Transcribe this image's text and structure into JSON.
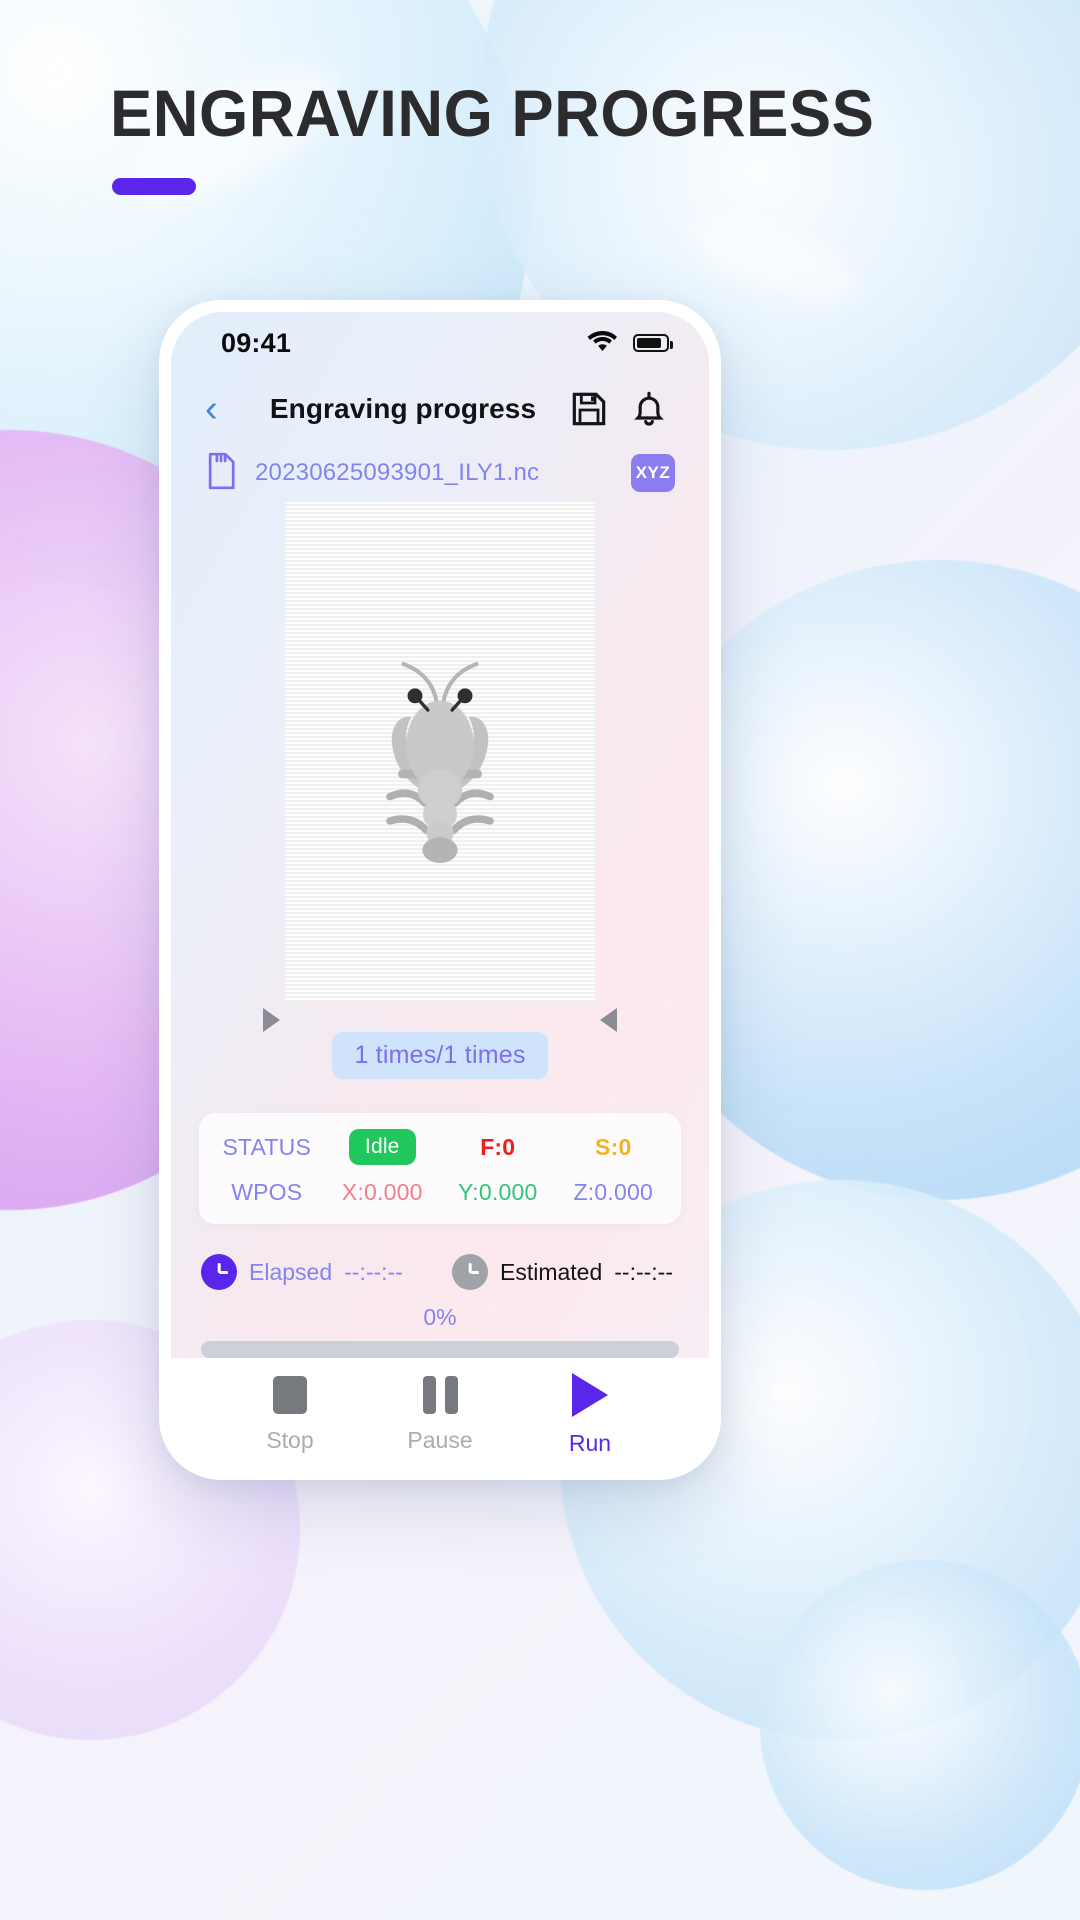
{
  "page": {
    "title": "ENGRAVING PROGRESS",
    "accent_color": "#5a27ea"
  },
  "statusbar": {
    "time": "09:41",
    "wifi_icon": "wifi-icon",
    "battery_icon": "battery-icon"
  },
  "appbar": {
    "back_icon": "chevron-left-icon",
    "title": "Engraving progress",
    "save_icon": "save-icon",
    "bell_icon": "bell-icon"
  },
  "file": {
    "sd_icon": "sd-card-icon",
    "name": "20230625093901_ILY1.nc",
    "axis_badge": "XYZ"
  },
  "preview": {
    "image_alt": "lobster-engraving-preview",
    "left_marker": "triangle-right-marker",
    "right_marker": "triangle-left-marker",
    "times": "1 times/1 times"
  },
  "status_panel": {
    "rows": [
      {
        "label": "STATUS",
        "cells": [
          {
            "name": "status-value",
            "text": "Idle",
            "color": "#ffffff",
            "bg": "#20c75c"
          },
          {
            "name": "feed-rate",
            "text": "F:0",
            "color": "#ef1d1d"
          },
          {
            "name": "spindle-speed",
            "text": "S:0",
            "color": "#f0b323"
          }
        ]
      },
      {
        "label": "WPOS",
        "cells": [
          {
            "name": "x-position",
            "text": "X:0.000",
            "color": "#f08089"
          },
          {
            "name": "y-position",
            "text": "Y:0.000",
            "color": "#34c47a"
          },
          {
            "name": "z-position",
            "text": "Z:0.000",
            "color": "#8285ee"
          }
        ]
      }
    ]
  },
  "timers": {
    "elapsed_label": "Elapsed",
    "elapsed_value": "--:--:--",
    "estimated_label": "Estimated",
    "estimated_value": "--:--:--"
  },
  "progress": {
    "percent_text": "0%",
    "percent_value": 0
  },
  "controls": [
    {
      "name": "stop-button",
      "label": "Stop",
      "icon": "stop-square-icon",
      "state": "disabled"
    },
    {
      "name": "pause-button",
      "label": "Pause",
      "icon": "pause-bars-icon",
      "state": "disabled"
    },
    {
      "name": "run-button",
      "label": "Run",
      "icon": "play-triangle-icon",
      "state": "active"
    }
  ]
}
